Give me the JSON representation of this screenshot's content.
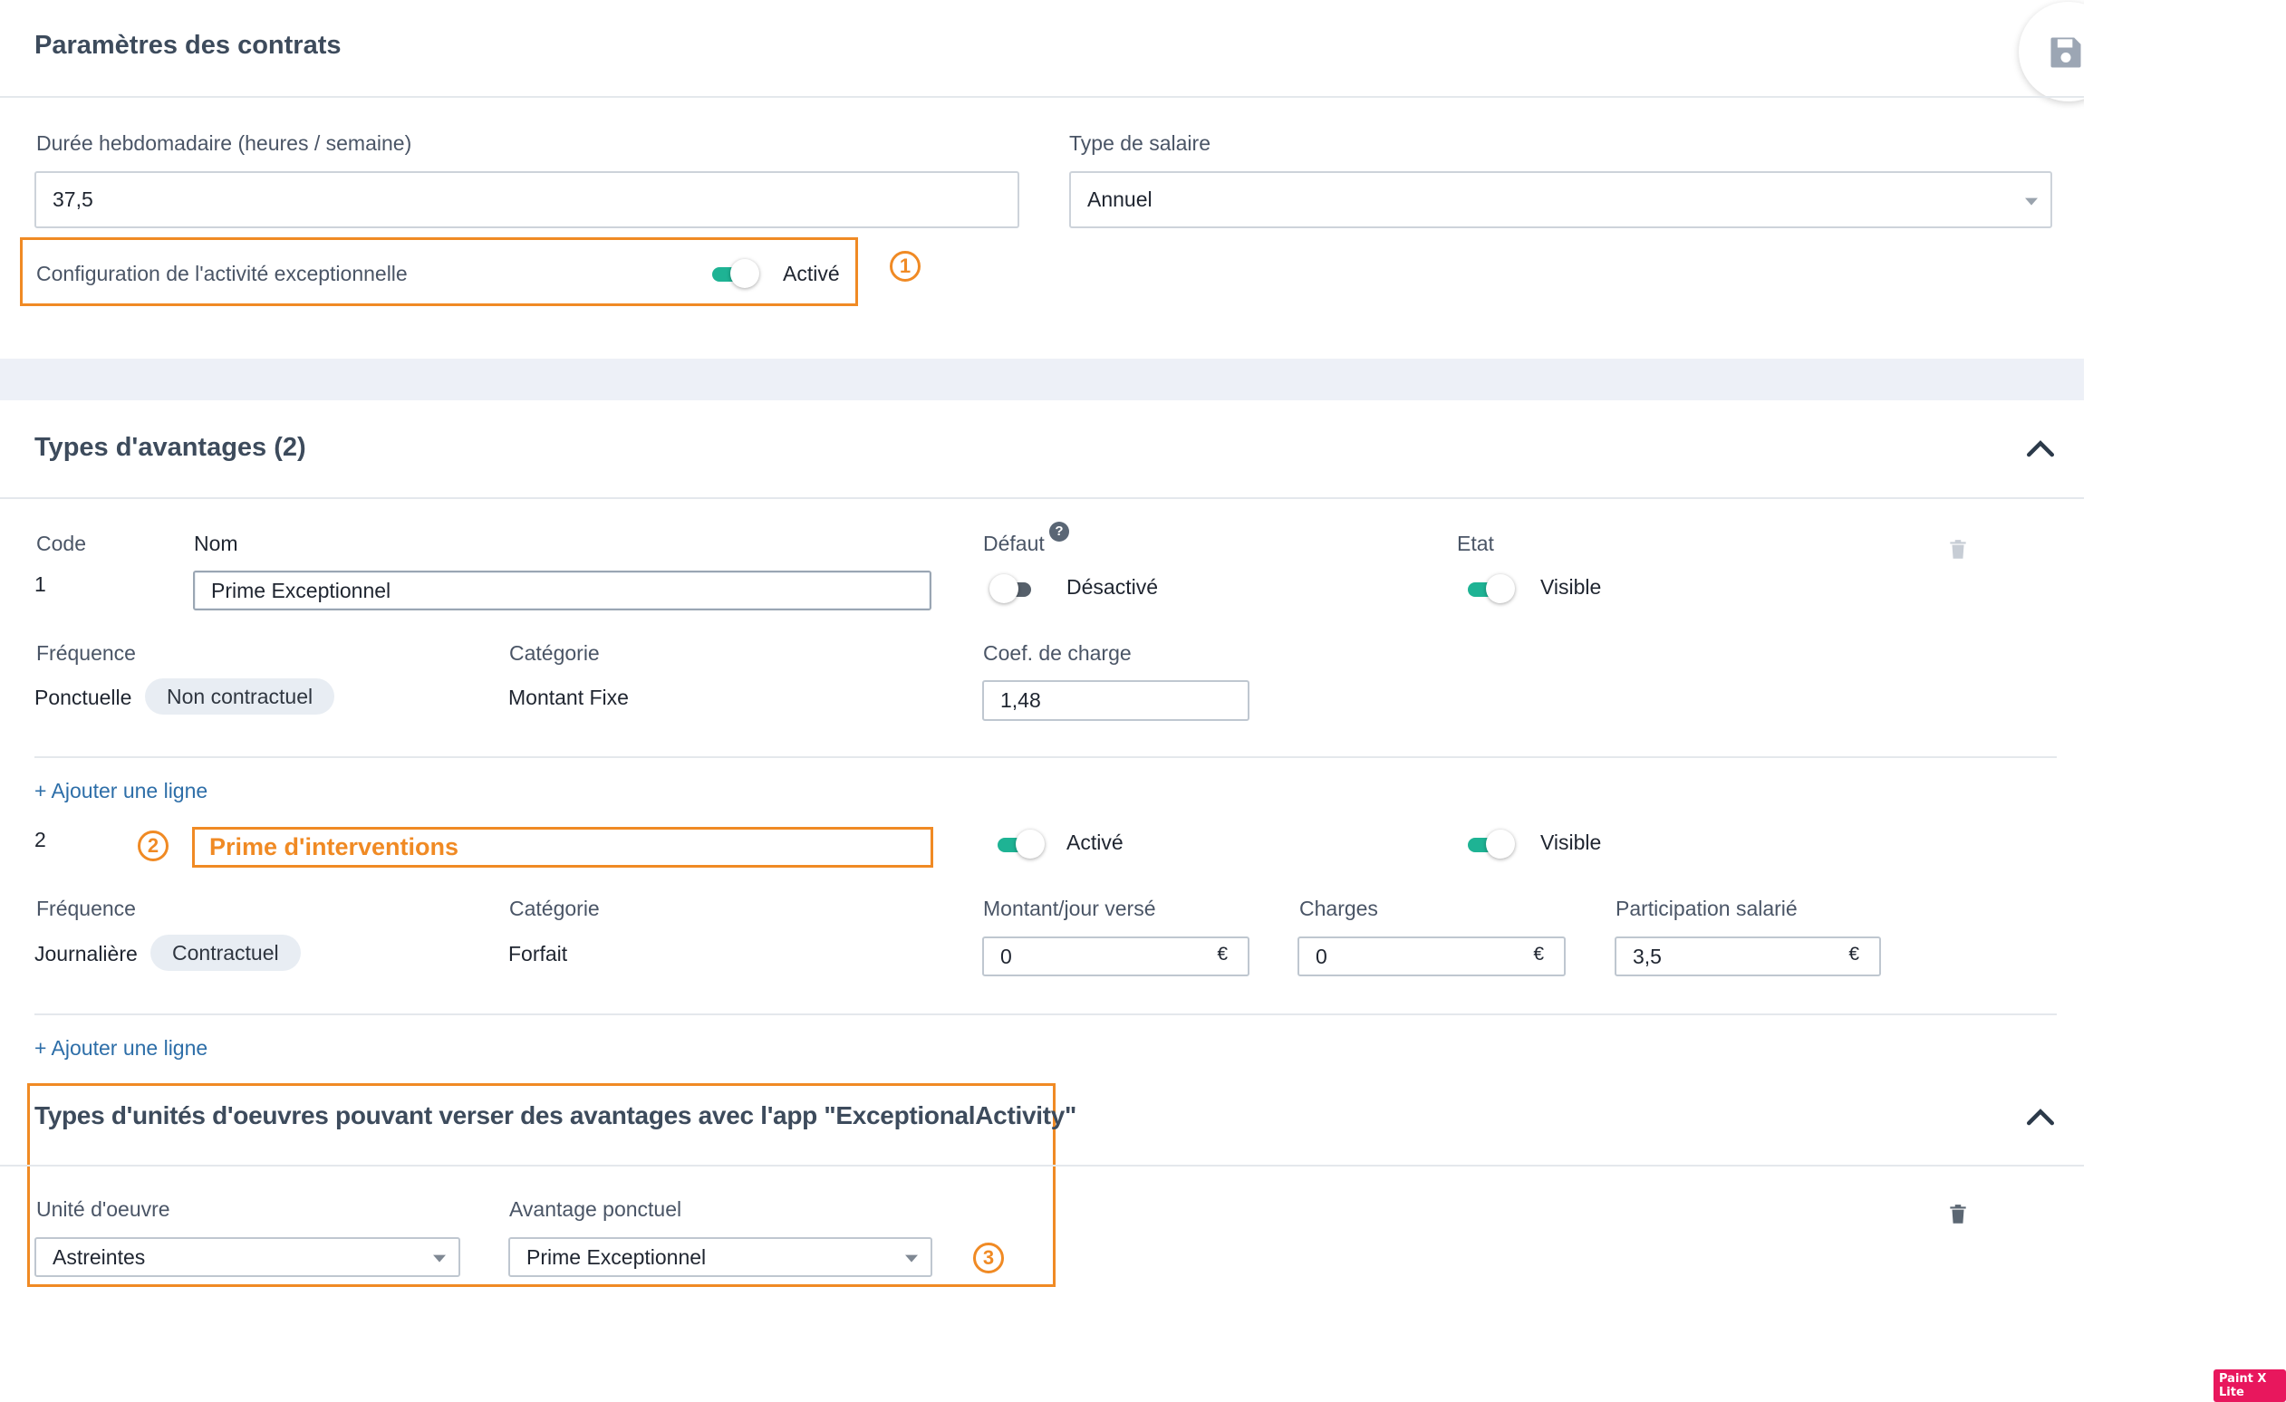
{
  "section1": {
    "title": "Paramètres des contrats",
    "weekly_label": "Durée hebdomadaire (heures / semaine)",
    "weekly_value": "37,5",
    "salary_label": "Type de salaire",
    "salary_value": "Annuel",
    "exceptional_label": "Configuration de l'activité exceptionnelle",
    "exceptional_state": "Activé",
    "marker_1": "1"
  },
  "section2": {
    "title": "Types d'avantages (2)",
    "headers": {
      "code": "Code",
      "name": "Nom",
      "default": "Défaut",
      "state": "Etat"
    },
    "help_glyph": "?",
    "row1": {
      "code": "1",
      "name": "Prime Exceptionnel",
      "default_state": "Désactivé",
      "visibility": "Visible",
      "frequency_label": "Fréquence",
      "frequency_value": "Ponctuelle",
      "contract_badge": "Non contractuel",
      "category_label": "Catégorie",
      "category_value": "Montant Fixe",
      "coef_label": "Coef. de charge",
      "coef_value": "1,48"
    },
    "add_line": "+ Ajouter une ligne",
    "row2": {
      "code": "2",
      "marker": "2",
      "name": "Prime d'interventions",
      "default_state": "Activé",
      "visibility": "Visible",
      "frequency_label": "Fréquence",
      "frequency_value": "Journalière",
      "contract_badge": "Contractuel",
      "category_label": "Catégorie",
      "category_value": "Forfait",
      "amount_label": "Montant/jour versé",
      "amount_value": "0",
      "charges_label": "Charges",
      "charges_value": "0",
      "participation_label": "Participation salarié",
      "participation_value": "3,5",
      "currency": "€"
    },
    "add_line_2": "+ Ajouter une ligne"
  },
  "section3": {
    "title": "Types d'unités d'oeuvres pouvant verser des avantages avec l'app \"ExceptionalActivity\"",
    "unit_label": "Unité d'oeuvre",
    "unit_value": "Astreintes",
    "benefit_label": "Avantage ponctuel",
    "benefit_value": "Prime Exceptionnel",
    "marker_3": "3"
  },
  "watermark": "Paint X Lite",
  "colors": {
    "accent": "#1eb394",
    "annotation": "#f08a24",
    "link": "#2d6ea8",
    "band": "#edf0f7"
  },
  "icons": [
    "save-icon",
    "chevron-up-icon",
    "trash-icon",
    "help-icon"
  ]
}
